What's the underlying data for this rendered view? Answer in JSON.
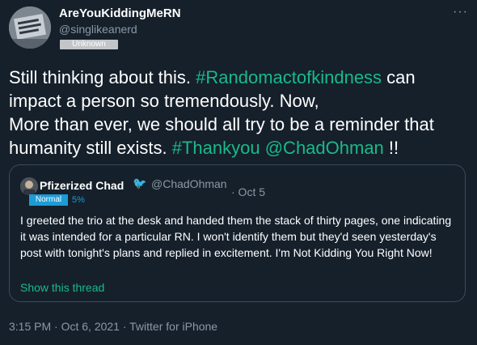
{
  "author": {
    "display_name": "AreYouKiddingMeRN",
    "handle": "@singlikeanerd",
    "label": "Unknown"
  },
  "tweet": {
    "text_1": "Still thinking about this. ",
    "hashtag_1": "#Randomactofkindness",
    "text_2": " can impact a person so tremendously. Now,",
    "text_3": "More than ever, we should all try to be a reminder that humanity still exists. ",
    "hashtag_2": "#Thankyou",
    "mention": "@ChadOhman",
    "text_4": " !!"
  },
  "quoted": {
    "display_name": "Pfizerized Chad",
    "verified_glyph": "🐦",
    "handle": "@ChadOhman",
    "date": "· Oct 5",
    "label": "Normal",
    "percent": "5%",
    "body": "I greeted the trio at the desk and handed them the stack of thirty pages, one indicating it was intended for a particular RN. I won't identify them but they'd seen yesterday's post with tonight's plans and replied in excitement. I'm Not Kidding You Right Now!",
    "show_thread": "Show this thread"
  },
  "meta": {
    "timestamp": "3:15 PM · Oct 6, 2021 · Twitter for iPhone"
  },
  "more_icon": "···",
  "colors": {
    "background": "#15202b",
    "accent": "#1ab98a",
    "secondary": "#8b98a5",
    "badge_normal": "#1c9bd6",
    "badge_unknown": "#c3c6c9"
  }
}
